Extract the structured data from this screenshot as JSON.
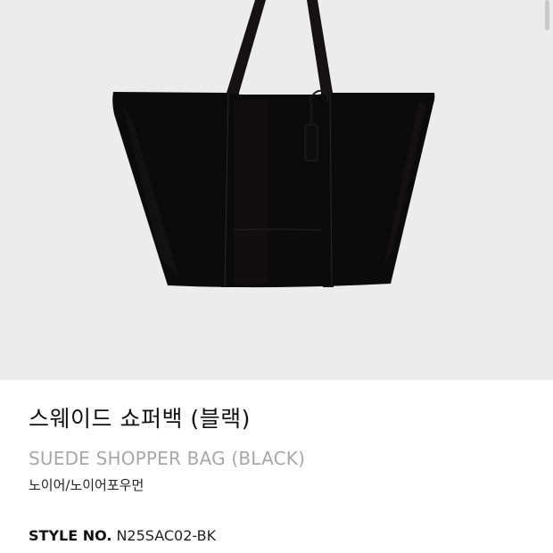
{
  "product": {
    "name_ko": "스웨이드 쇼퍼백 (블랙)",
    "name_en": "SUEDE SHOPPER BAG (BLACK)",
    "brand": "노이어/노이어포우먼",
    "style_label": "STYLE NO.",
    "style_number": "N25SAC02-BK",
    "color": "#0b0a0a"
  },
  "image": {
    "background": "#ececec"
  }
}
